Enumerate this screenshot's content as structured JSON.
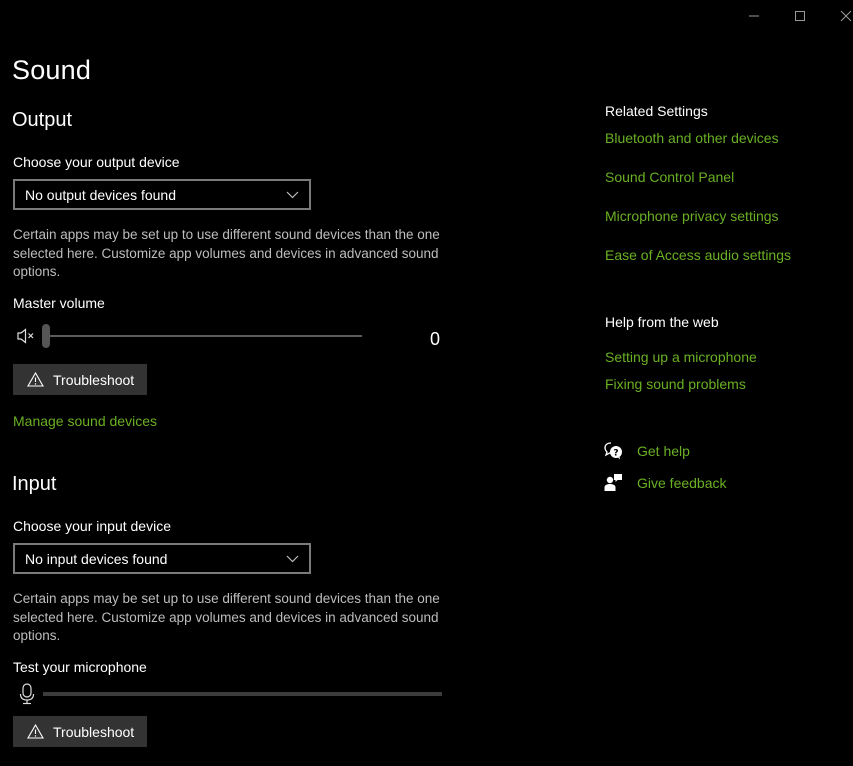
{
  "window": {
    "controls": [
      {
        "name": "minimize",
        "icon": "minimize-icon"
      },
      {
        "name": "maximize",
        "icon": "maximize-icon"
      },
      {
        "name": "close",
        "icon": "close-icon"
      }
    ]
  },
  "page": {
    "title": "Sound"
  },
  "output": {
    "heading": "Output",
    "device_label": "Choose your output device",
    "device_value": "No output devices found",
    "description": "Certain apps may be set up to use different sound devices than the one selected here. Customize app volumes and devices in advanced sound options.",
    "volume_label": "Master volume",
    "volume_icon": "speaker-muted-icon",
    "volume_value": "0",
    "volume_fraction": 0,
    "troubleshoot_label": "Troubleshoot",
    "manage_link": "Manage sound devices"
  },
  "input": {
    "heading": "Input",
    "device_label": "Choose your input device",
    "device_value": "No input devices found",
    "description": "Certain apps may be set up to use different sound devices than the one selected here. Customize app volumes and devices in advanced sound options.",
    "test_label": "Test your microphone",
    "mic_icon": "microphone-icon",
    "mic_level_fraction": 0,
    "troubleshoot_label": "Troubleshoot"
  },
  "sidebar": {
    "related_heading": "Related Settings",
    "related_links": [
      "Bluetooth and other devices",
      "Sound Control Panel",
      "Microphone privacy settings",
      "Ease of Access audio settings"
    ],
    "help_heading": "Help from the web",
    "help_links": [
      "Setting up a microphone",
      "Fixing sound problems"
    ],
    "get_help": "Get help",
    "give_feedback": "Give feedback"
  },
  "colors": {
    "accent_link": "#6ab023",
    "background": "#000000",
    "button_bg": "#333333"
  }
}
